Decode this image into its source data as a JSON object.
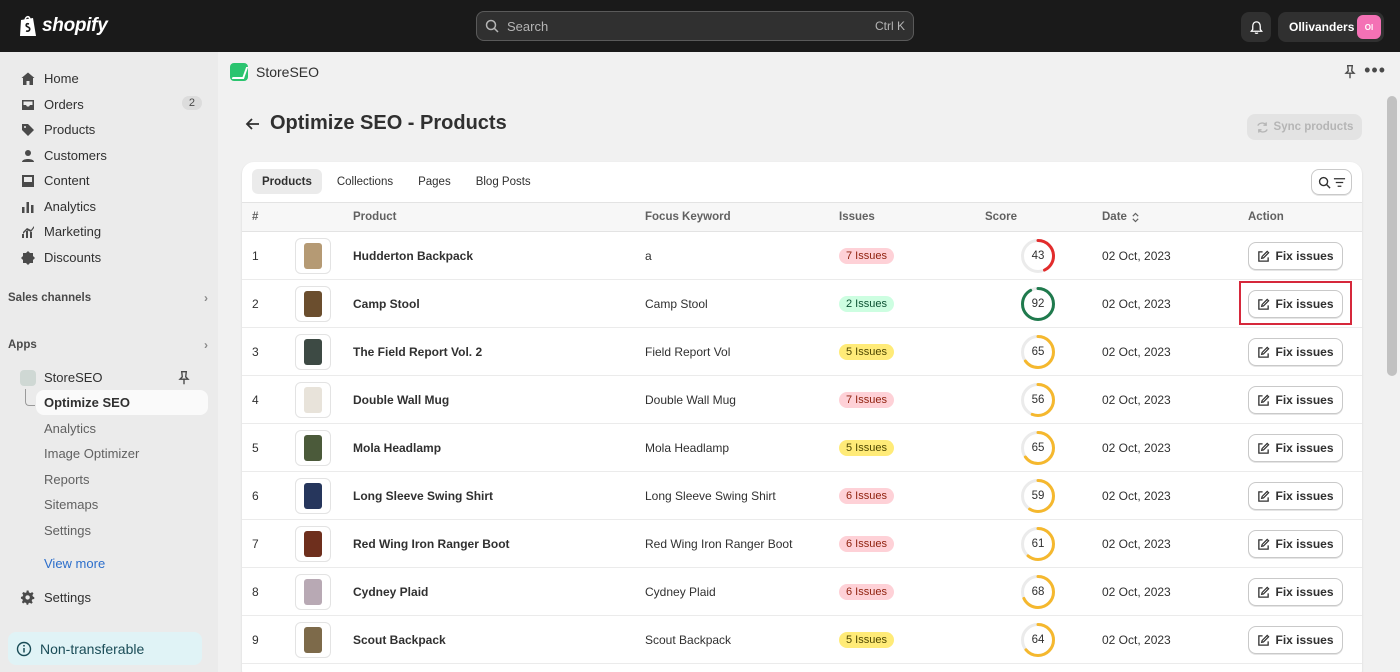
{
  "topbar": {
    "brand": "shopify",
    "search_placeholder": "Search",
    "search_shortcut": "Ctrl K",
    "store_name": "Ollivanders",
    "avatar_initials": "Ol"
  },
  "sidebar": {
    "items": [
      {
        "label": "Home",
        "icon": "home-icon"
      },
      {
        "label": "Orders",
        "icon": "orders-icon",
        "count": "2"
      },
      {
        "label": "Products",
        "icon": "products-icon"
      },
      {
        "label": "Customers",
        "icon": "customers-icon"
      },
      {
        "label": "Content",
        "icon": "content-icon"
      },
      {
        "label": "Analytics",
        "icon": "analytics-icon"
      },
      {
        "label": "Marketing",
        "icon": "marketing-icon"
      },
      {
        "label": "Discounts",
        "icon": "discounts-icon"
      }
    ],
    "sales_channels": "Sales channels",
    "apps": "Apps",
    "app_name": "StoreSEO",
    "app_sub_items": [
      "Optimize SEO",
      "Analytics",
      "Image Optimizer",
      "Reports",
      "Sitemaps",
      "Settings"
    ],
    "view_more": "View more",
    "settings": "Settings",
    "non_transferable": "Non-transferable"
  },
  "app_header": {
    "name": "StoreSEO"
  },
  "page": {
    "title": "Optimize SEO - Products",
    "sync_label": "Sync products",
    "tabs": [
      "Products",
      "Collections",
      "Pages",
      "Blog Posts"
    ],
    "columns": [
      "#",
      "Product",
      "Focus Keyword",
      "Issues",
      "Score",
      "Date",
      "Action"
    ],
    "action_label": "Fix issues",
    "rows": [
      {
        "n": "1",
        "product": "Hudderton Backpack",
        "keyword": "a",
        "issues": "7 Issues",
        "level": "red",
        "score": 43,
        "date": "02 Oct, 2023"
      },
      {
        "n": "2",
        "product": "Camp Stool",
        "keyword": "Camp Stool",
        "issues": "2 Issues",
        "level": "green",
        "score": 92,
        "date": "02 Oct, 2023"
      },
      {
        "n": "3",
        "product": "The Field Report Vol. 2",
        "keyword": "Field Report Vol",
        "issues": "5 Issues",
        "level": "yellow",
        "score": 65,
        "date": "02 Oct, 2023"
      },
      {
        "n": "4",
        "product": "Double Wall Mug",
        "keyword": "Double Wall Mug",
        "issues": "7 Issues",
        "level": "red",
        "score": 56,
        "date": "02 Oct, 2023"
      },
      {
        "n": "5",
        "product": "Mola Headlamp",
        "keyword": "Mola Headlamp",
        "issues": "5 Issues",
        "level": "yellow",
        "score": 65,
        "date": "02 Oct, 2023"
      },
      {
        "n": "6",
        "product": "Long Sleeve Swing Shirt",
        "keyword": "Long Sleeve Swing Shirt",
        "issues": "6 Issues",
        "level": "red",
        "score": 59,
        "date": "02 Oct, 2023"
      },
      {
        "n": "7",
        "product": "Red Wing Iron Ranger Boot",
        "keyword": "Red Wing Iron Ranger Boot",
        "issues": "6 Issues",
        "level": "red",
        "score": 61,
        "date": "02 Oct, 2023"
      },
      {
        "n": "8",
        "product": "Cydney Plaid",
        "keyword": "Cydney Plaid",
        "issues": "6 Issues",
        "level": "red",
        "score": 68,
        "date": "02 Oct, 2023"
      },
      {
        "n": "9",
        "product": "Scout Backpack",
        "keyword": "Scout Backpack",
        "issues": "5 Issues",
        "level": "yellow",
        "score": 64,
        "date": "02 Oct, 2023"
      }
    ]
  },
  "colors": {
    "score_red": "#e22c2c",
    "score_green": "#1f7a4d",
    "score_yellow": "#f5b82e",
    "highlight": "#d6283b"
  }
}
